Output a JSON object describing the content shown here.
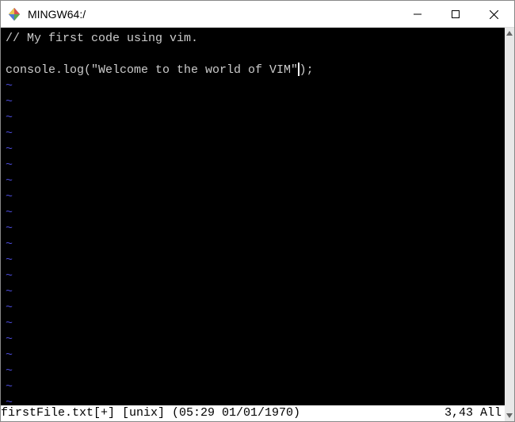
{
  "window": {
    "title": "MINGW64:/"
  },
  "editor": {
    "lines": [
      "// My first code using vim.",
      "",
      "console.log(\"Welcome to the world of VIM\");"
    ],
    "cursor_line_index": 2,
    "cursor_col": 41,
    "tilde": "~",
    "tilde_count": 21
  },
  "status": {
    "filename": "firstFile.txt",
    "modified_flag": "[+]",
    "format": "[unix]",
    "timestamp": "(05:29 01/01/1970)",
    "position": "3,43",
    "view": "All"
  }
}
